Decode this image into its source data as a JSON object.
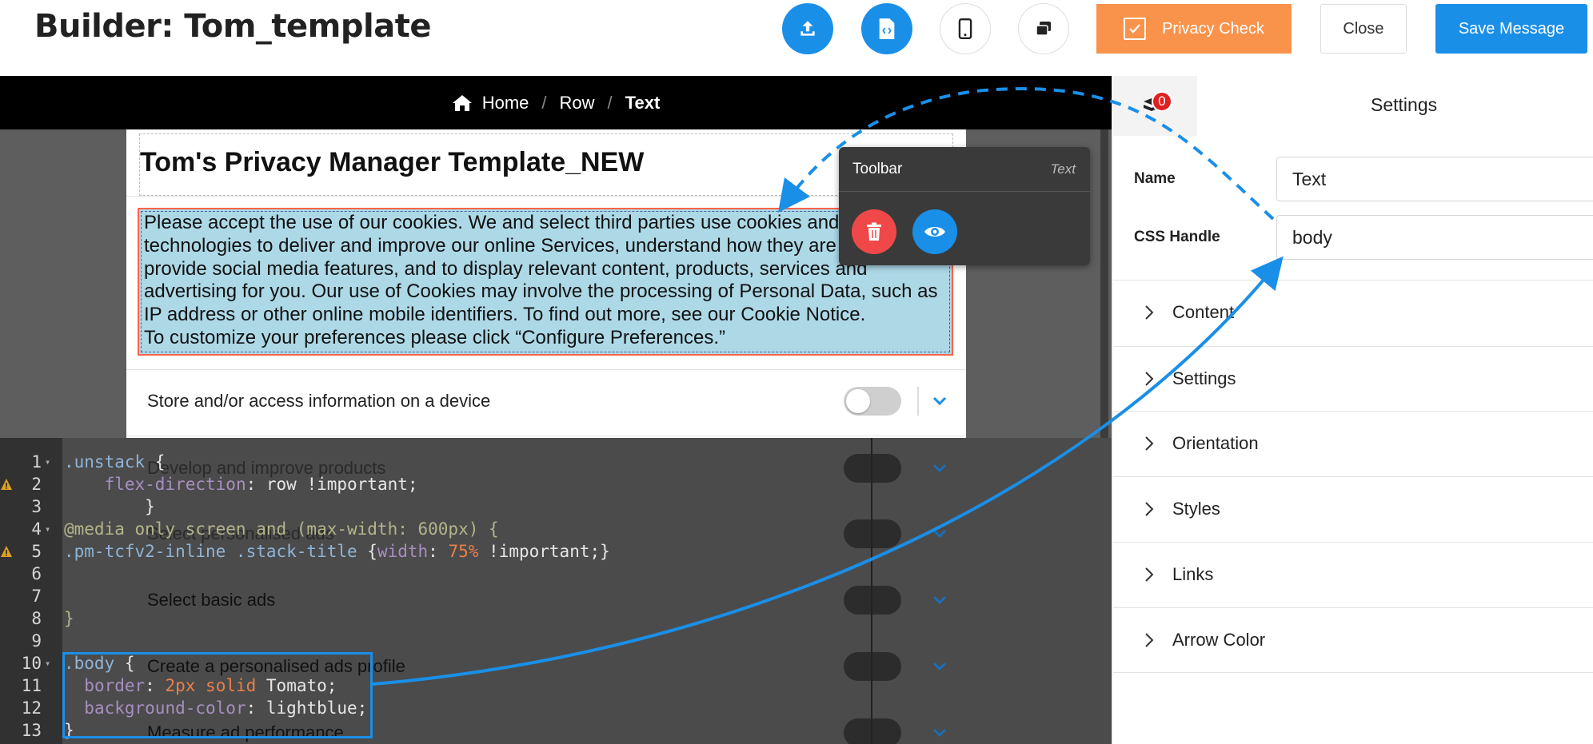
{
  "header": {
    "title": "Builder: Tom_template",
    "privacy_check_label": "Privacy Check",
    "close_label": "Close",
    "save_label": "Save Message"
  },
  "breadcrumb": {
    "items": [
      "Home",
      "Row",
      "Text"
    ],
    "separator": "/"
  },
  "canvas": {
    "title": "Tom's Privacy Manager Template_NEW",
    "text_lines": [
      "Please accept the use of our cookies. We and select third parties use cookies and",
      "technologies to deliver and improve our online Services, understand how they are",
      "provide social media features, and to display relevant content, products, services and",
      "advertising for you. Our use of Cookies may involve the processing of Personal Data, such as",
      "IP address or other online mobile identifiers. To find out more, see our Cookie Notice.",
      "To customize your preferences please click “Configure Preferences.”"
    ],
    "preferences": [
      "Store and/or access information on a device",
      "Develop and improve products",
      "Select personalised ads",
      "Select basic ads",
      "Create a personalised ads profile",
      "Measure ad performance"
    ]
  },
  "toolbar": {
    "title": "Toolbar",
    "kind": "Text"
  },
  "editor": {
    "line_numbers": [
      "1",
      "2",
      "3",
      "4",
      "5",
      "6",
      "7",
      "8",
      "9",
      "10",
      "11",
      "12",
      "13"
    ]
  },
  "panel": {
    "badge_count": "0",
    "title": "Settings",
    "name_label": "Name",
    "name_value": "Text",
    "css_handle_label": "CSS Handle",
    "css_handle_value": "body",
    "sections": [
      "Content",
      "Settings",
      "Orientation",
      "Styles",
      "Links",
      "Arrow Color"
    ]
  },
  "colors": {
    "accent_blue": "#1a8fe8",
    "privacy_orange": "#f9934b",
    "selection_bg": "#add8e6",
    "selection_border": "#ff6347",
    "delete_red": "#f04848"
  }
}
